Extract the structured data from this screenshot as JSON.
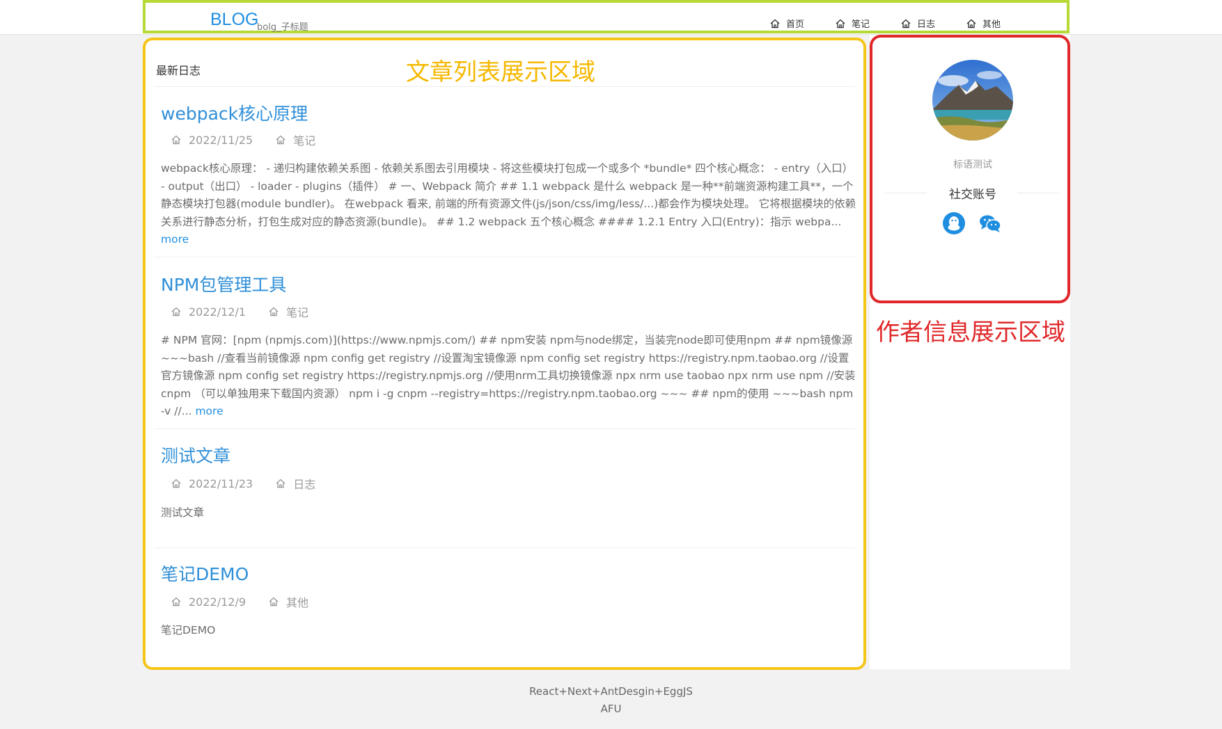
{
  "header": {
    "logo": "BLOG",
    "subtitle": "bolg_子标题",
    "nav": [
      {
        "label": "首页"
      },
      {
        "label": "笔记"
      },
      {
        "label": "日志"
      },
      {
        "label": "其他"
      }
    ]
  },
  "annotations": {
    "list_area": "文章列表展示区域",
    "author_area": "作者信息展示区域"
  },
  "main": {
    "heading": "最新日志",
    "articles": [
      {
        "title": "webpack核心原理",
        "date": "2022/11/25",
        "category": "笔记",
        "excerpt": "webpack核心原理： - 递归构建依赖关系图 - 依赖关系图去引用模块 - 将这些模块打包成一个或多个 *bundle* 四个核心概念： - entry（入口） - output（出口） - loader - plugins（插件） # 一、Webpack 简介 ## 1.1 webpack 是什么 webpack 是一种**前端资源构建工具**，一个静态模块打包器(module bundler)。 在webpack 看来, 前端的所有资源文件(js/json/css/img/less/...)都会作为模块处理。 它将根据模块的依赖关系进行静态分析，打包生成对应的静态资源(bundle)。 ## 1.2 webpack 五个核心概念 #### 1.2.1 Entry 入口(Entry)：指示 webpa...",
        "more": "more"
      },
      {
        "title": "NPM包管理工具",
        "date": "2022/12/1",
        "category": "笔记",
        "excerpt": "# NPM 官网：[npm (npmjs.com)](https://www.npmjs.com/) ## npm安装 npm与node绑定，当装完node即可使用npm ## npm镜像源 ~~~bash //查看当前镜像源 npm config get registry //设置淘宝镜像源 npm config set registry https://registry.npm.taobao.org //设置官方镜像源 npm config set registry https://registry.npmjs.org //使用nrm工具切换镜像源 npx nrm use taobao npx nrm use npm //安装cnpm （可以单独用来下载国内资源） npm i -g cnpm --registry=https://registry.npm.taobao.org ~~~ ## npm的使用 ~~~bash npm -v //...",
        "more": "more"
      },
      {
        "title": "测试文章",
        "date": "2022/11/23",
        "category": "日志",
        "excerpt": "测试文章",
        "more": ""
      },
      {
        "title": "笔记DEMO",
        "date": "2022/12/9",
        "category": "其他",
        "excerpt": "笔记DEMO",
        "more": ""
      }
    ]
  },
  "author": {
    "motto": "标语测试",
    "social_title": "社交账号",
    "icons": [
      "qq-icon",
      "wechat-icon"
    ],
    "colors": {
      "qq": "#1f8ee0",
      "wechat": "#1f8ee0"
    }
  },
  "footer": {
    "stack": "React+Next+AntDesgin+EggJS",
    "author": "AFU"
  },
  "colors": {
    "accent": "#2f8fd8",
    "header_frame": "#b7d936",
    "list_frame": "#f5c518",
    "author_frame": "#e0282a"
  }
}
